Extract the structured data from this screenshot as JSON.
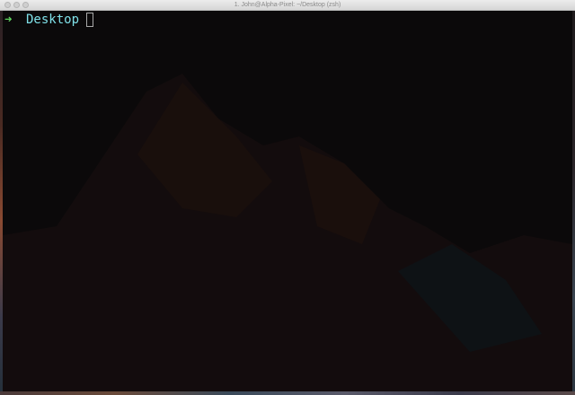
{
  "window": {
    "title": "1. John@Alpha-Pixel: ~/Desktop (zsh)"
  },
  "terminal": {
    "prompt_arrow_icon": "arrow-right-icon",
    "cwd": "Desktop",
    "input": ""
  },
  "colors": {
    "background": "#0b090a",
    "arrow": "#5fd35f",
    "directory": "#7fe0e8",
    "cursor": "#a9a9a9"
  }
}
